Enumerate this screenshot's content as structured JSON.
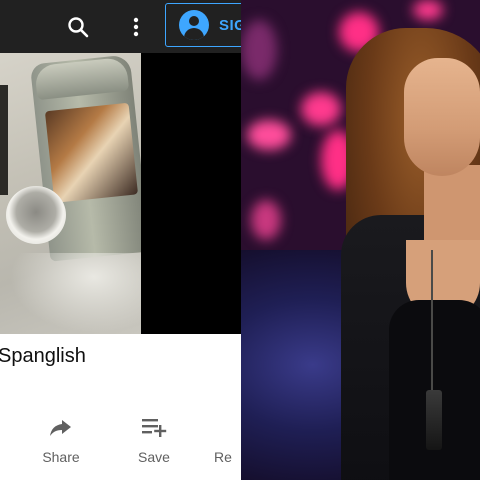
{
  "topbar": {
    "search_icon": "search-icon",
    "more_icon": "more-vertical-icon",
    "signin_label": "SIGN IN",
    "accent_color": "#3ea6ff",
    "bar_color": "#212121"
  },
  "video": {
    "title": "Spanglish"
  },
  "actions": {
    "share_label": "Share",
    "save_label": "Save",
    "remix_label": "Re"
  },
  "photo": {
    "description_icon": "concert-photo"
  }
}
